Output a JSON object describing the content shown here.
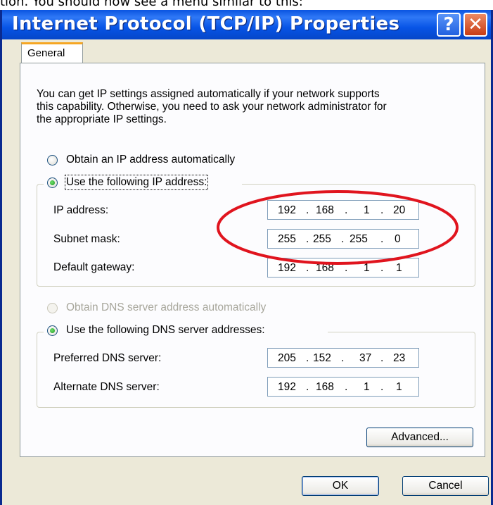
{
  "caption": "tion. You should now see a menu similar to this:",
  "window": {
    "title": "Internet Protocol (TCP/IP) Properties",
    "help_label": "?",
    "close_label": "✕"
  },
  "tab": {
    "label": "General"
  },
  "description": {
    "line1": "You can get IP settings assigned automatically if your network supports",
    "line2": "this capability. Otherwise, you need to ask your network administrator for",
    "line3": "the appropriate IP settings."
  },
  "ip_section": {
    "auto_label": "Obtain an IP address automatically",
    "manual_label": "Use the following IP address:",
    "selected": "manual",
    "fields": {
      "ip_label": "IP address:",
      "ip": [
        "192",
        "168",
        "1",
        "20"
      ],
      "subnet_label": "Subnet mask:",
      "subnet": [
        "255",
        "255",
        "255",
        "0"
      ],
      "gateway_label": "Default gateway:",
      "gateway": [
        "192",
        "168",
        "1",
        "1"
      ]
    }
  },
  "dns_section": {
    "auto_label": "Obtain DNS server address automatically",
    "manual_label": "Use the following DNS server addresses:",
    "selected": "manual",
    "fields": {
      "preferred_label": "Preferred DNS server:",
      "preferred": [
        "205",
        "152",
        "37",
        "23"
      ],
      "alternate_label": "Alternate DNS server:",
      "alternate": [
        "192",
        "168",
        "1",
        "1"
      ]
    }
  },
  "buttons": {
    "advanced": "Advanced...",
    "ok": "OK",
    "cancel": "Cancel"
  },
  "annotation_color": "#E0141E"
}
